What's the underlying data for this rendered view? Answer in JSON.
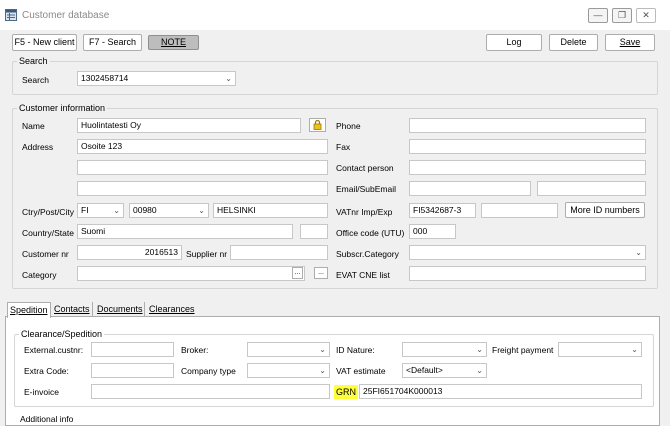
{
  "window": {
    "title": "Customer database",
    "minimize_icon": "minimize-icon",
    "restore_icon": "restore-icon",
    "close_icon": "close-icon"
  },
  "toolbar": {
    "new_client_label": "F5 - New client",
    "search_label": "F7 - Search",
    "note_label": "NOTE",
    "log_label": "Log",
    "delete_label": "Delete",
    "save_label": "Save"
  },
  "search": {
    "group_label": "Search",
    "label": "Search",
    "value": "1302458714"
  },
  "customer": {
    "group_label": "Customer information",
    "name_label": "Name",
    "name_value": "Huolintatesti Oy",
    "address_label": "Address",
    "address_line1": "Osoite 123",
    "address_line2": "",
    "address_line3": "",
    "ctry_label": "Ctry/Post/City",
    "country_code": "FI",
    "postal_code": "00980",
    "city": "HELSINKI",
    "country_state_label": "Country/State",
    "country_value": "Suomi",
    "state_value": "",
    "customer_nr_label": "Customer nr",
    "customer_nr_value": "2016513",
    "supplier_nr_label": "Supplier nr",
    "supplier_nr_value": "",
    "category_label": "Category",
    "category_value": "",
    "phone_label": "Phone",
    "phone_value": "",
    "fax_label": "Fax",
    "fax_value": "",
    "contact_label": "Contact person",
    "contact_value": "",
    "email_label": "Email/SubEmail",
    "email_value": "",
    "subemail_value": "",
    "vat_label": "VATnr Imp/Exp",
    "vat_imp_value": "FI5342687-3",
    "vat_exp_value": "",
    "more_id_label": "More ID numbers",
    "office_label": "Office code (UTU)",
    "office_value": "000",
    "subscr_label": "Subscr.Category",
    "subscr_value": "",
    "evat_label": "EVAT CNE list",
    "evat_value": ""
  },
  "tabs": [
    "Spedition",
    "Contacts",
    "Documents",
    "Clearances"
  ],
  "spedition": {
    "group_label": "Clearance/Spedition",
    "external_label": "External.custnr:",
    "external_value": "",
    "broker_label": "Broker:",
    "broker_value": "",
    "id_nature_label": "ID Nature:",
    "id_nature_value": "",
    "freight_label": "Freight payment",
    "freight_value": "",
    "extra_code_label": "Extra Code:",
    "extra_code_value": "",
    "company_type_label": "Company type",
    "company_type_value": "",
    "vat_estimate_label": "VAT estimate",
    "vat_estimate_value": "<Default>",
    "einvoice_label": "E-invoice",
    "einvoice_value": "",
    "grn_label": "GRN",
    "grn_value": "25FI651704K000013"
  },
  "additional": {
    "label": "Additional info"
  },
  "colors": {
    "highlight": "#ffff3a",
    "pressed_button": "#bdbdbd"
  }
}
